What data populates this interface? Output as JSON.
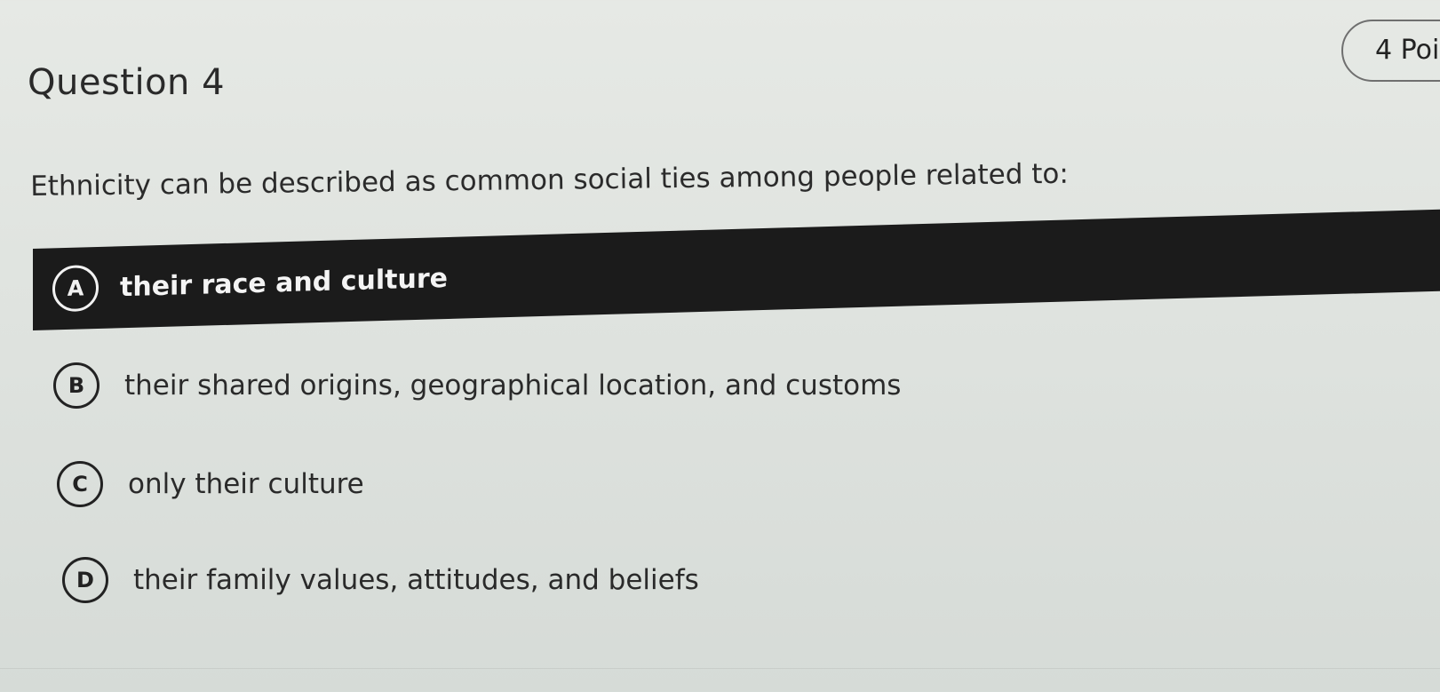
{
  "question": {
    "title": "Question 4",
    "points": "4 Poi",
    "prompt": "Ethnicity can be described as common social ties among people related to:"
  },
  "options": [
    {
      "letter": "A",
      "text": "their race and culture",
      "selected": true
    },
    {
      "letter": "B",
      "text": "their shared origins, geographical location, and customs",
      "selected": false
    },
    {
      "letter": "C",
      "text": "only their culture",
      "selected": false
    },
    {
      "letter": "D",
      "text": "their family values, attitudes, and beliefs",
      "selected": false
    }
  ],
  "colors": {
    "selected_background": "#1b1b1b",
    "selected_text": "#f4f4f4",
    "page_background": "#e1e5e1"
  }
}
